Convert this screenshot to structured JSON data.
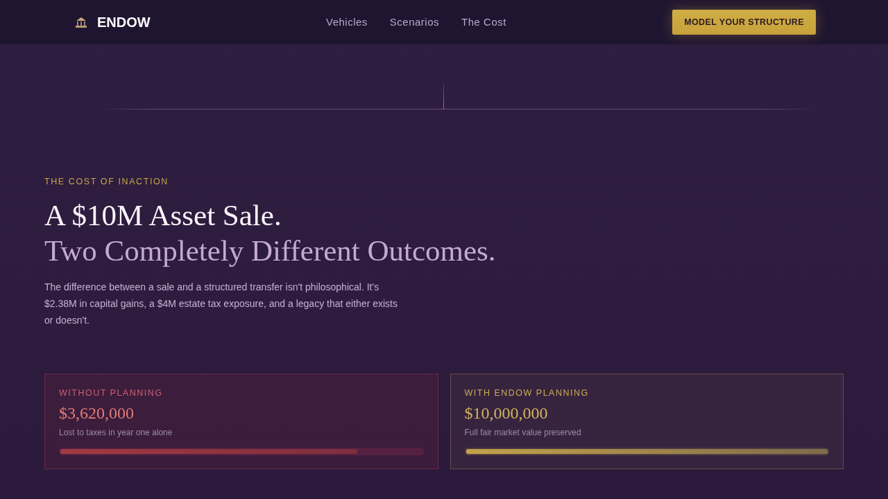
{
  "nav": {
    "brand": "ENDOW",
    "links": [
      "Vehicles",
      "Scenarios",
      "The Cost"
    ],
    "cta": "MODEL YOUR STRUCTURE"
  },
  "hero": {
    "eyebrow": "THE COST OF INACTION",
    "headline": "A $10M Asset Sale.",
    "headline_sub": "Two Completely Different Outcomes.",
    "body": "The difference between a sale and a structured transfer isn't philosophical. It's $2.38M in capital gains, a $4M estate tax exposure, and a legacy that either exists or doesn't."
  },
  "cards": [
    {
      "kind": "loss",
      "label": "WITHOUT PLANNING",
      "amount": "$3,620,000",
      "caption": "Lost to taxes in year one alone",
      "level": 0.82
    },
    {
      "kind": "gain",
      "label": "WITH ENDOW PLANNING",
      "amount": "$10,000,000",
      "caption": "Full fair market value preserved",
      "level": 1
    }
  ]
}
